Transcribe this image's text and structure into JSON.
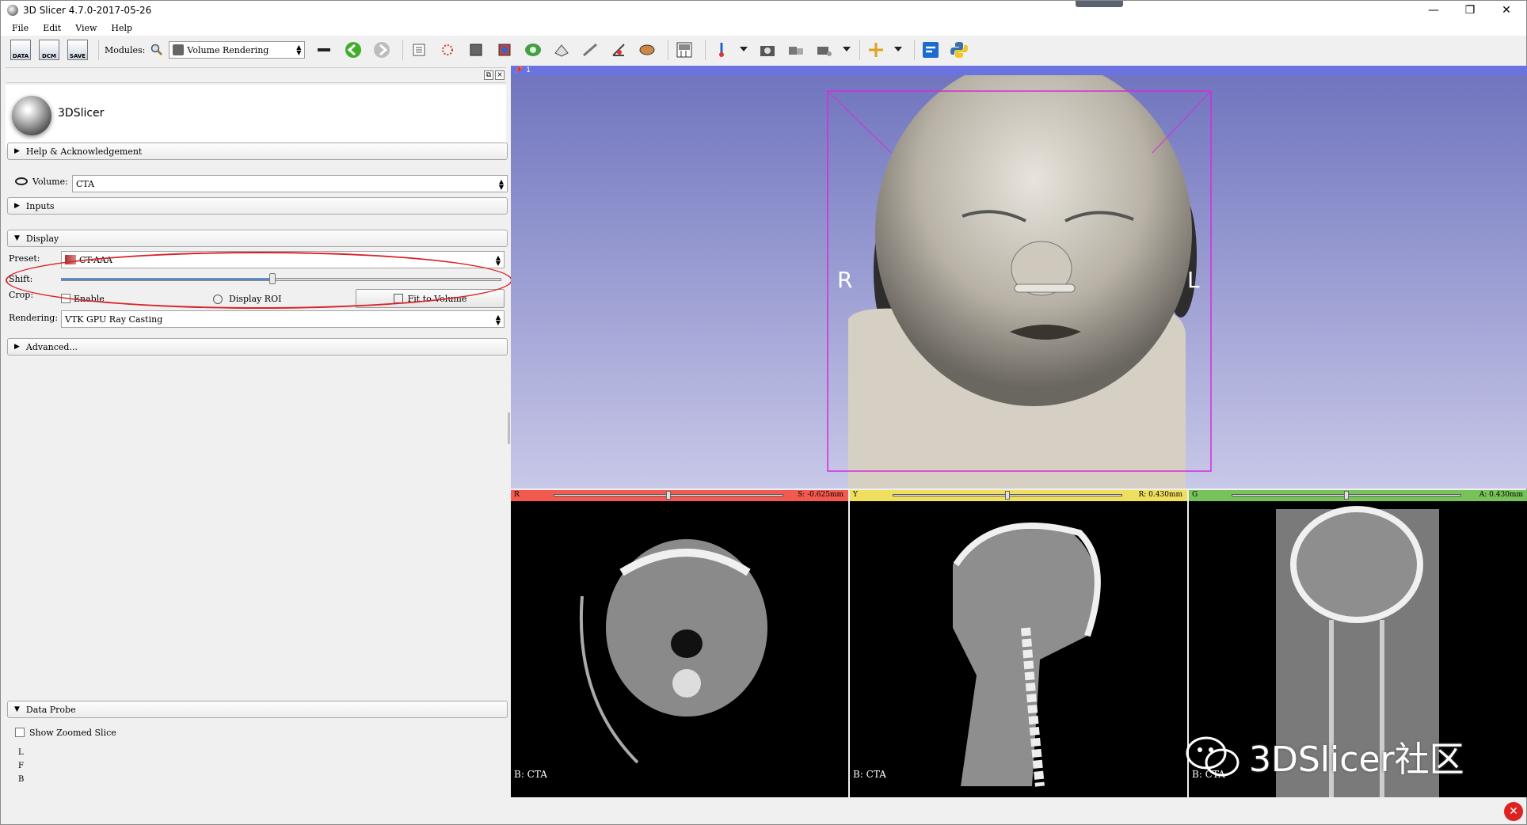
{
  "window": {
    "title": "3D Slicer 4.7.0-2017-05-26",
    "controls": {
      "minimize": "—",
      "restore": "❐",
      "close": "✕"
    }
  },
  "menu": [
    "File",
    "Edit",
    "View",
    "Help"
  ],
  "toolbar": {
    "data_label": "DATA",
    "dcm_label": "DCM",
    "save_label": "SAVE",
    "modules_label": "Modules:",
    "module_selected": "Volume Rendering"
  },
  "panel": {
    "logo_text": "3DSlicer",
    "help_section": "Help & Acknowledgement",
    "volume_label": "Volume:",
    "volume_value": "CTA",
    "inputs_section": "Inputs",
    "display_section": "Display",
    "preset_label": "Preset:",
    "preset_value": "CT-AAA",
    "shift_label": "Shift:",
    "crop_label": "Crop:",
    "enable_label": "Enable",
    "display_roi_label": "Display ROI",
    "fit_to_volume_label": "Fit to Volume",
    "rendering_label": "Rendering:",
    "rendering_value": "VTK GPU Ray Casting",
    "advanced_section": "Advanced...",
    "data_probe_section": "Data Probe",
    "show_zoomed_slice": "Show Zoomed Slice",
    "probe_lines": [
      "L",
      "F",
      "B"
    ],
    "shift_fraction": 0.48
  },
  "view3d": {
    "tag": "1",
    "left_marker": "R",
    "right_marker": "L"
  },
  "slices": [
    {
      "tag": "R",
      "value": "S: -0.625mm",
      "label": "B: CTA",
      "color": "#f25a4f",
      "position": 0.5
    },
    {
      "tag": "Y",
      "value": "R: 0.430mm",
      "label": "B: CTA",
      "color": "#f0df5e",
      "position": 0.5
    },
    {
      "tag": "G",
      "value": "A: 0.430mm",
      "label": "B: CTA",
      "color": "#77c25a",
      "position": 0.5
    }
  ],
  "watermark": "3DSlicer社区",
  "colors": {
    "view3d_bar": "#6b73e0",
    "highlight": "#d8232a",
    "roi_box": "#d82ad8"
  }
}
